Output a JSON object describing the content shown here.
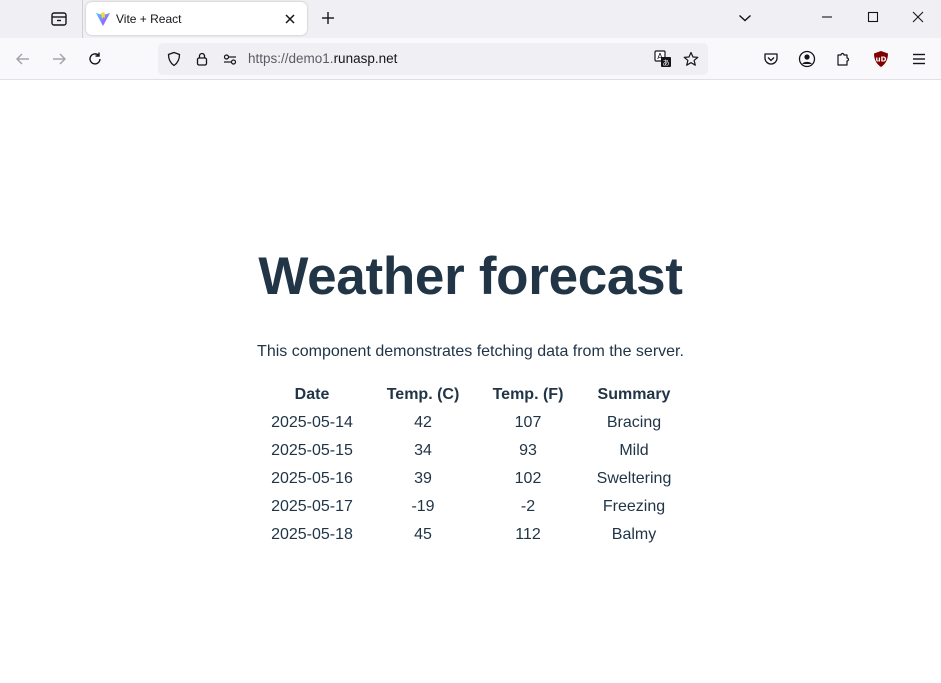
{
  "browser": {
    "tab": {
      "title": "Vite + React"
    },
    "url": {
      "prefix": "https://demo1.",
      "host": "runasp.net"
    },
    "icons": {
      "overview": "tab-overview-icon",
      "favicon": "vite-logo-icon",
      "close": "close-icon",
      "new_tab": "plus-icon",
      "tab_list": "chevron-down-icon",
      "back": "back-arrow-icon",
      "forward": "forward-arrow-icon",
      "reload": "reload-icon",
      "shield": "shield-icon",
      "lock": "lock-icon",
      "permissions": "permissions-icon",
      "translate": "translate-icon",
      "bookmark": "star-icon",
      "pocket": "pocket-icon",
      "account": "account-icon",
      "extensions": "puzzle-icon",
      "ublock": "ublock-icon",
      "menu": "hamburger-menu-icon"
    }
  },
  "page": {
    "title": "Weather forecast",
    "intro": "This component demonstrates fetching data from the server.",
    "table": {
      "headers": [
        "Date",
        "Temp. (C)",
        "Temp. (F)",
        "Summary"
      ],
      "rows": [
        [
          "2025-05-14",
          "42",
          "107",
          "Bracing"
        ],
        [
          "2025-05-15",
          "34",
          "93",
          "Mild"
        ],
        [
          "2025-05-16",
          "39",
          "102",
          "Sweltering"
        ],
        [
          "2025-05-17",
          "-19",
          "-2",
          "Freezing"
        ],
        [
          "2025-05-18",
          "45",
          "112",
          "Balmy"
        ]
      ]
    }
  },
  "colors": {
    "text": "#213547",
    "tabstrip": "#f0f0f4",
    "navbar": "#f9f9fb",
    "ublock": "#800000"
  }
}
